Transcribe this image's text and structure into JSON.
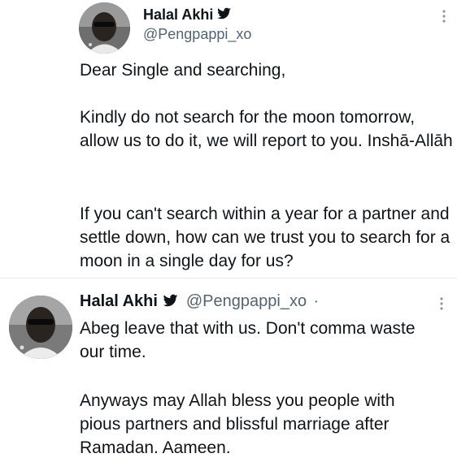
{
  "tweets": [
    {
      "name": "Halal Akhi",
      "handle": "@Pengpappi_xo",
      "paragraphs": [
        "Dear Single and searching,",
        "Kindly do not search for the moon tomorrow, allow us to do it, we will report to you. Inshā-Allāh",
        "If you can't search within a year for a partner and settle down, how can we trust you to search for a moon in a single day for us?"
      ]
    },
    {
      "name": "Halal Akhi",
      "handle": "@Pengpappi_xo",
      "separator": "·",
      "paragraphs": [
        "Abeg leave that with us. Don't comma waste our time.",
        "Anyways may Allah bless you people with pious partners and blissful marriage after Ramadan. Aameen."
      ]
    }
  ],
  "icons": {
    "verified": "verified-badge-icon",
    "more": "more-options-icon",
    "avatar": "profile-avatar"
  }
}
